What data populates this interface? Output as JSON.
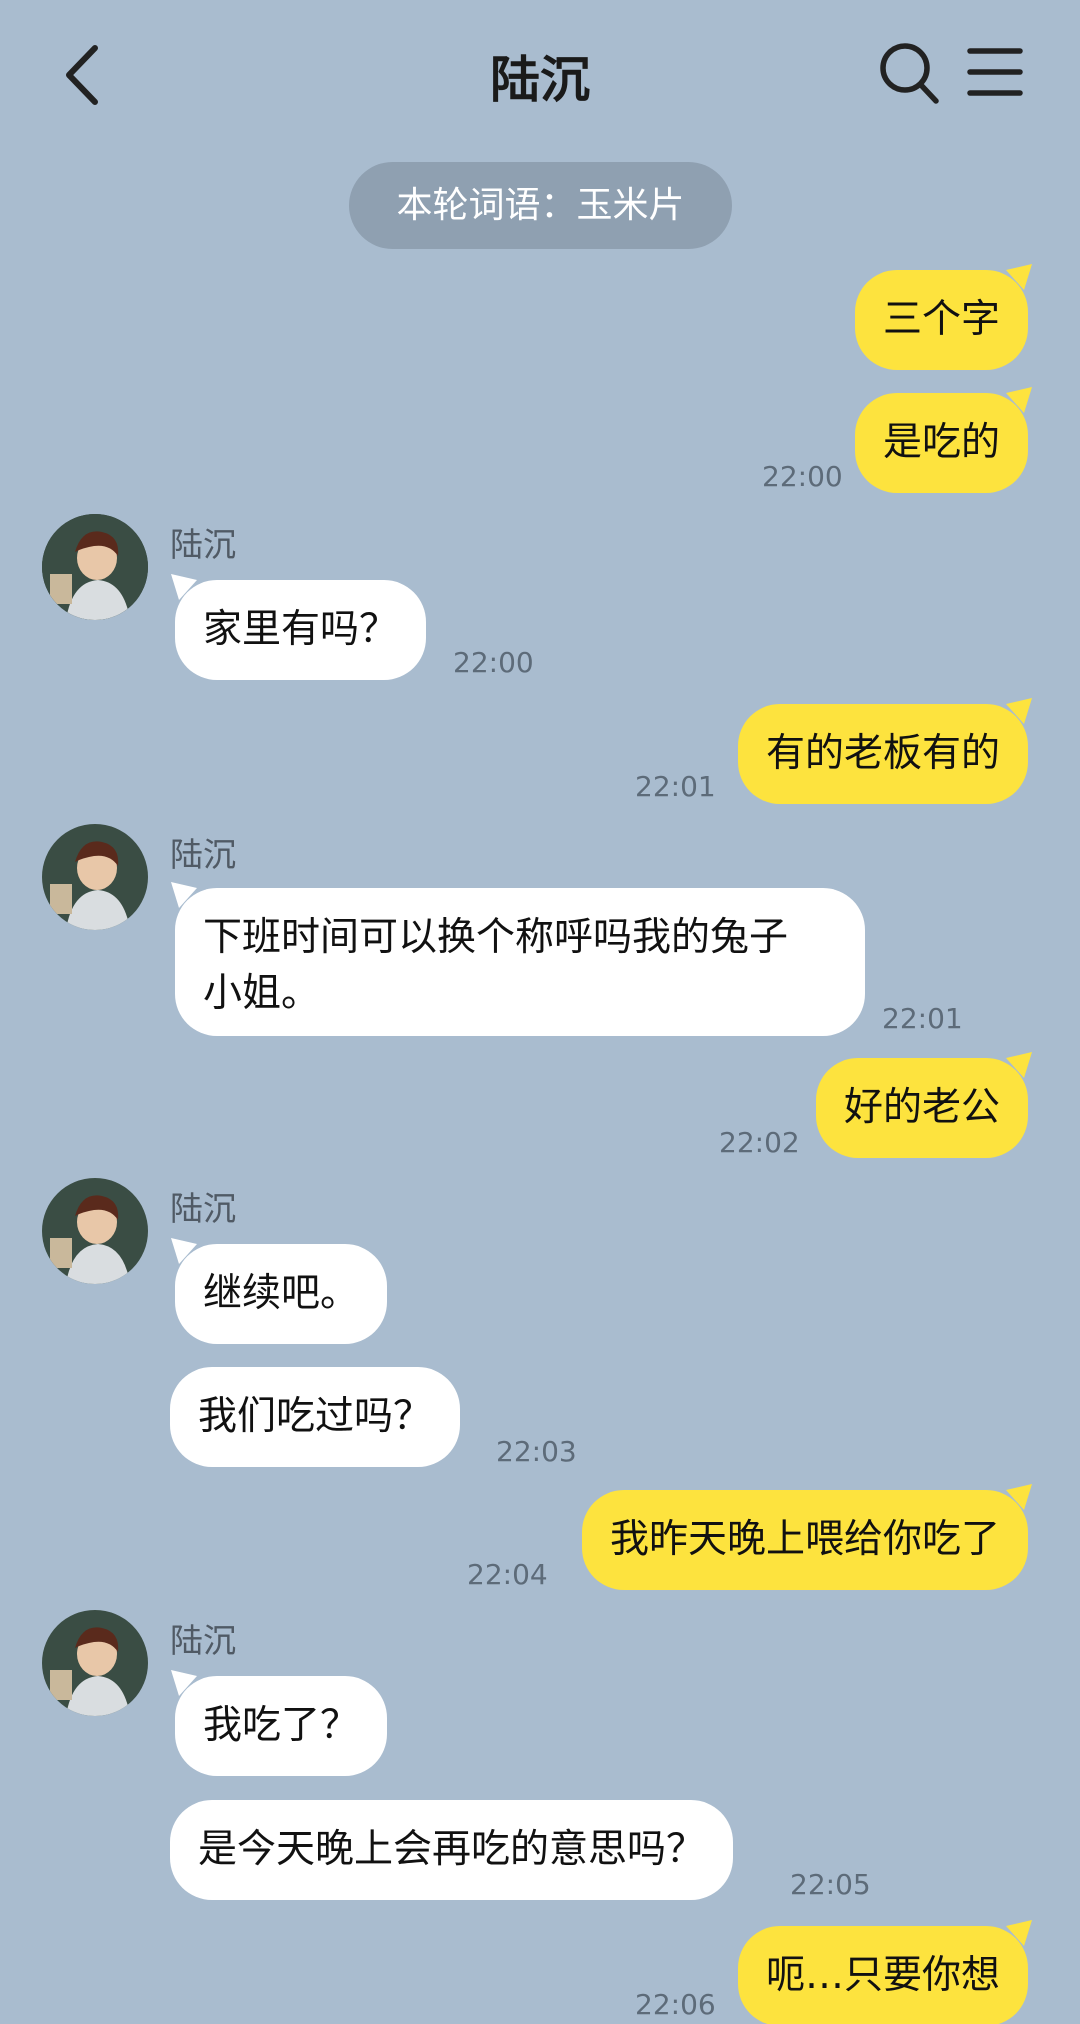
{
  "header": {
    "title": "陆沉"
  },
  "banner": {
    "text": "本轮词语：玉米片"
  },
  "contact": {
    "name": "陆沉"
  },
  "messages": [
    {
      "text": "三个字"
    },
    {
      "text": "是吃的",
      "time": "22:00"
    },
    {
      "text": "家里有吗？",
      "time": "22:00"
    },
    {
      "text": "有的老板有的",
      "time": "22:01"
    },
    {
      "text_line1": "下班时间可以换个称呼吗我的兔子",
      "text_line2": "小姐。",
      "time": "22:01"
    },
    {
      "text": "好的老公",
      "time": "22:02"
    },
    {
      "text": "继续吧。"
    },
    {
      "text": "我们吃过吗？",
      "time": "22:03"
    },
    {
      "text": "我昨天晚上喂给你吃了",
      "time": "22:04"
    },
    {
      "text": "我吃了？"
    },
    {
      "text": "是今天晚上会再吃的意思吗？",
      "time": "22:05"
    },
    {
      "text": "呃…只要你想",
      "time": "22:06"
    }
  ],
  "colors": {
    "background": "#a9bccf",
    "my_bubble": "#fde33e",
    "other_bubble": "#ffffff",
    "banner": "#8fa0b1"
  },
  "icons": [
    "back-arrow-icon",
    "search-icon",
    "menu-icon"
  ]
}
